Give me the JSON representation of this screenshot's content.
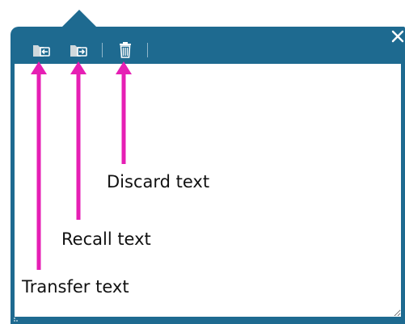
{
  "popup": {
    "toolbar": {
      "transfer_icon": "folder-transfer-icon",
      "recall_icon": "folder-recall-icon",
      "discard_icon": "trash-icon",
      "close_icon": "close-icon"
    },
    "text_value": ""
  },
  "annotations": {
    "transfer": "Transfer text",
    "recall": "Recall text",
    "discard": "Discard text"
  },
  "colors": {
    "panel": "#1e6a90",
    "arrow": "#e61fb4"
  }
}
